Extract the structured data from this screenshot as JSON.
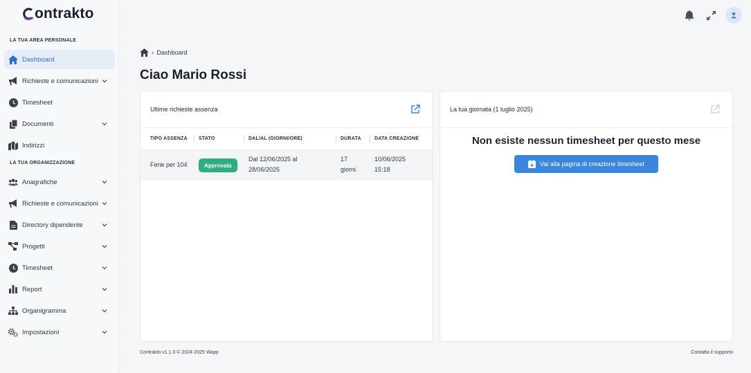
{
  "app": {
    "logo_text": "ontrakto",
    "brand_colors": {
      "primary": "#3b86dc",
      "success": "#2fae7f",
      "logo_gradient_from": "#2e6fc7",
      "logo_gradient_to": "#c2367c"
    }
  },
  "sidebar": {
    "personal_section_label": "LA TUA AREA PERSONALE",
    "personal_items": [
      {
        "label": "Dashboard",
        "icon": "home-icon",
        "active": true
      },
      {
        "label": "Richieste e comunicazioni",
        "icon": "megaphone-icon",
        "expandable": true
      },
      {
        "label": "Timesheet",
        "icon": "clock-icon"
      },
      {
        "label": "Documenti",
        "icon": "documents-icon",
        "expandable": true
      },
      {
        "label": "Indirizzi",
        "icon": "map-icon"
      }
    ],
    "org_section_label": "LA TUA ORGANIZZAZIONE",
    "org_items": [
      {
        "label": "Anagrafiche",
        "icon": "users-icon",
        "expandable": true
      },
      {
        "label": "Richieste e comunicazioni",
        "icon": "megaphone-icon",
        "expandable": true
      },
      {
        "label": "Directory dipendente",
        "icon": "file-icon",
        "expandable": true
      },
      {
        "label": "Progetti",
        "icon": "diagram-icon",
        "expandable": true
      },
      {
        "label": "Timesheet",
        "icon": "clock-icon",
        "expandable": true
      },
      {
        "label": "Report",
        "icon": "bar-chart-icon",
        "expandable": true
      },
      {
        "label": "Organigramma",
        "icon": "sitemap-icon",
        "expandable": true
      },
      {
        "label": "Impostazioni",
        "icon": "gears-icon",
        "expandable": true
      }
    ]
  },
  "header": {
    "icons": [
      "bell-icon",
      "expand-icon",
      "user-icon"
    ]
  },
  "breadcrumb": {
    "current": "Dashboard"
  },
  "page": {
    "greeting": "Ciao Mario Rossi"
  },
  "absence_card": {
    "title": "Ultime richieste assenza",
    "columns": [
      "TIPO ASSENZA",
      "STATO",
      "DAL/AL (GIORNI/ORE)",
      "DURATA",
      "DATA CREAZIONE"
    ],
    "rows": [
      {
        "type": "Ferie per 104",
        "status": "Approvata",
        "range_line1": "Dal 12/06/2025 al",
        "range_line2": "28/06/2025",
        "duration_line1": "17",
        "duration_line2": "giorni",
        "created_line1": "10/06/2025",
        "created_line2": "15:18"
      }
    ]
  },
  "day_card": {
    "title": "La tua giornata (1 luglio 2025)",
    "empty_message": "Non esiste nessun timesheet per questo mese",
    "button_label": "Vai alla pagina di creazione timesheet"
  },
  "footer": {
    "left": "Contrakto v1.1.0 © 2024-2025 Wapp",
    "right": "Contatta il supporto"
  }
}
